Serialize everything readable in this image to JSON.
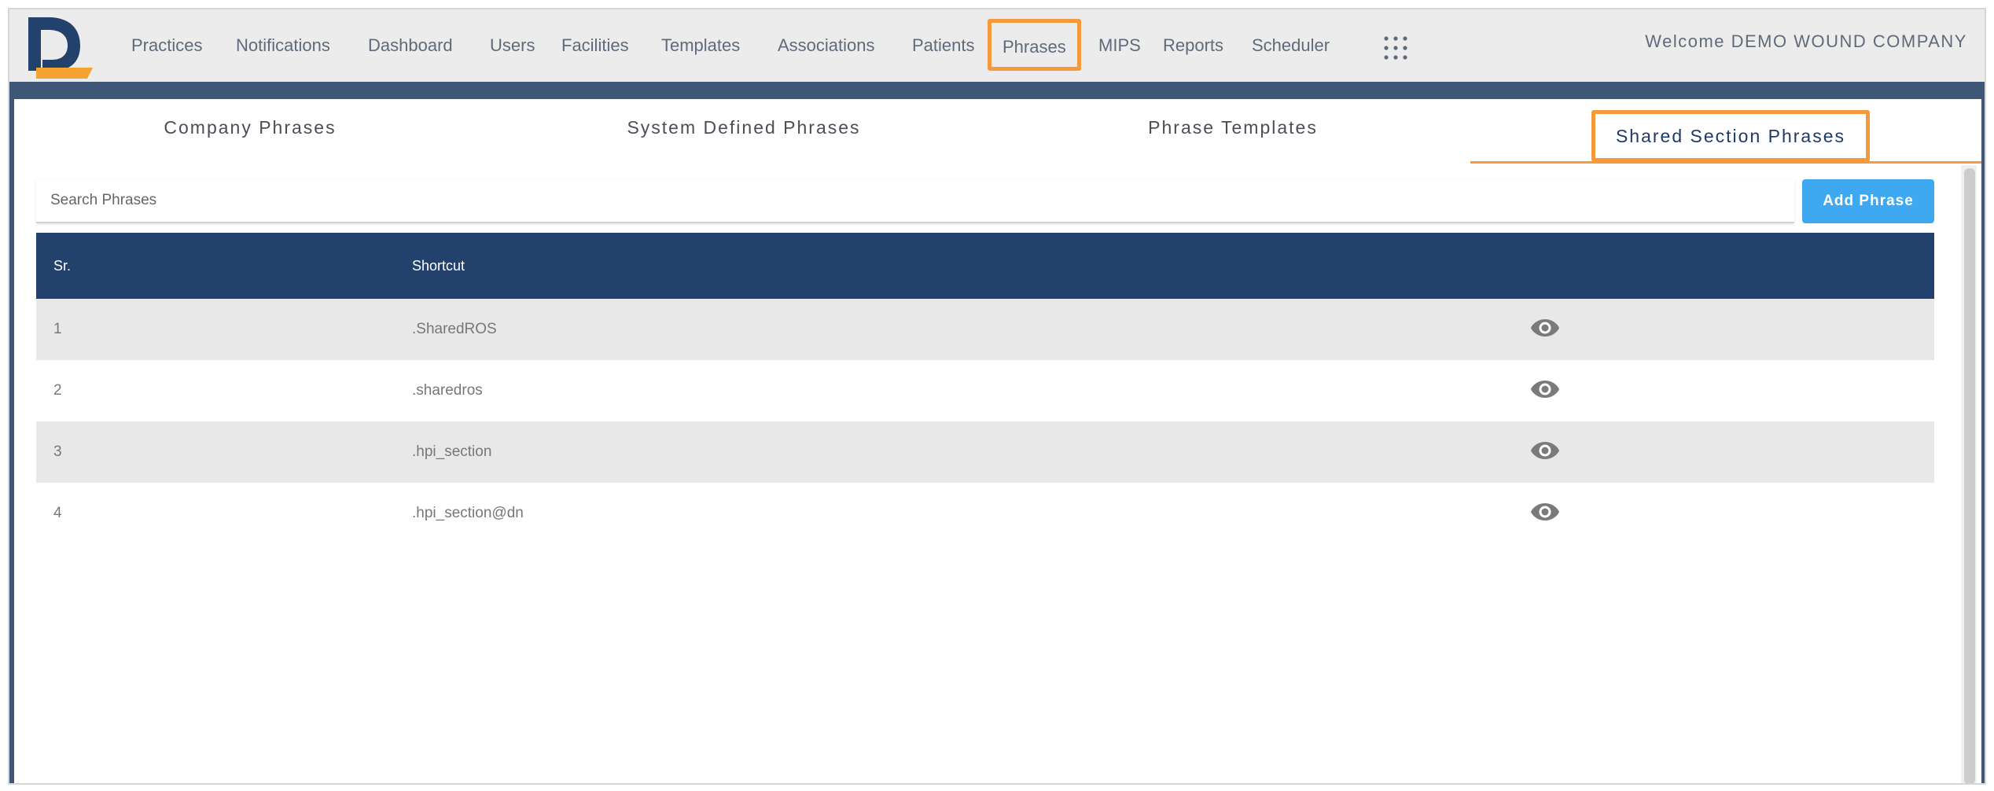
{
  "header": {
    "nav": [
      {
        "label": "Practices"
      },
      {
        "label": "Notifications"
      },
      {
        "label": "Dashboard"
      },
      {
        "label": "Users"
      },
      {
        "label": "Facilities"
      },
      {
        "label": "Templates"
      },
      {
        "label": "Associations"
      },
      {
        "label": "Patients"
      },
      {
        "label": "Phrases"
      },
      {
        "label": "MIPS"
      },
      {
        "label": "Reports"
      },
      {
        "label": "Scheduler"
      }
    ],
    "welcome": "Welcome DEMO WOUND COMPANY",
    "apps_icon": "grid-icon"
  },
  "tabs": [
    {
      "label": "Company Phrases"
    },
    {
      "label": "System Defined Phrases"
    },
    {
      "label": "Phrase Templates"
    },
    {
      "label": "Shared Section Phrases"
    }
  ],
  "search": {
    "placeholder": "Search Phrases",
    "value": ""
  },
  "add_button": {
    "label": "Add Phrase"
  },
  "table": {
    "headers": {
      "sr": "Sr.",
      "shortcut": "Shortcut"
    },
    "rows": [
      {
        "sr": "1",
        "shortcut": ".SharedROS"
      },
      {
        "sr": "2",
        "shortcut": ".sharedros"
      },
      {
        "sr": "3",
        "shortcut": ".hpi_section"
      },
      {
        "sr": "4",
        "shortcut": ".hpi_section@dn"
      }
    ],
    "row_action_icon": "eye-icon"
  },
  "colors": {
    "header_bg": "#ececec",
    "accent_orange": "#f59a3c",
    "table_header_bg": "#22416c",
    "button_blue": "#3ea9f0",
    "stripe_bar": "#3f5777"
  }
}
